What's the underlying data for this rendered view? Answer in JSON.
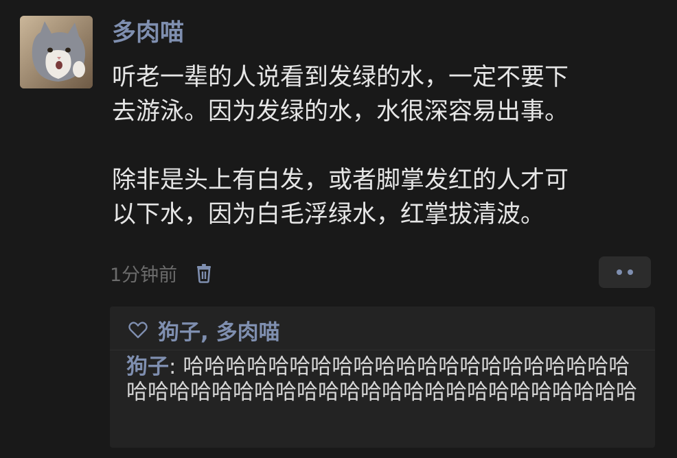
{
  "post": {
    "author": "多肉喵",
    "paragraphs": [
      "听老一辈的人说看到发绿的水，一定不要下\n去游泳。因为发绿的水，水很深容易出事。",
      "除非是头上有白发，或者脚掌发红的人才可\n以下水，因为白毛浮绿水，红掌拔清波。"
    ],
    "timestamp": "1分钟前",
    "delete_icon": "trash-icon",
    "more_icon": "ellipsis-icon"
  },
  "interactions": {
    "like_icon": "heart-icon",
    "liked_by": "狗子, 多肉喵",
    "comments": [
      {
        "author": "狗子",
        "separator": ": ",
        "text": "哈哈哈哈哈哈哈哈哈哈哈哈哈哈哈哈哈哈哈哈哈哈哈哈哈哈哈哈哈哈哈哈哈哈哈哈哈哈哈哈哈哈哈哈哈"
      }
    ]
  },
  "colors": {
    "background": "#191919",
    "panel": "#232323",
    "link_blue": "#7f8fb0",
    "body_text": "#e6e6e6",
    "muted_text": "#6b6b6b"
  }
}
